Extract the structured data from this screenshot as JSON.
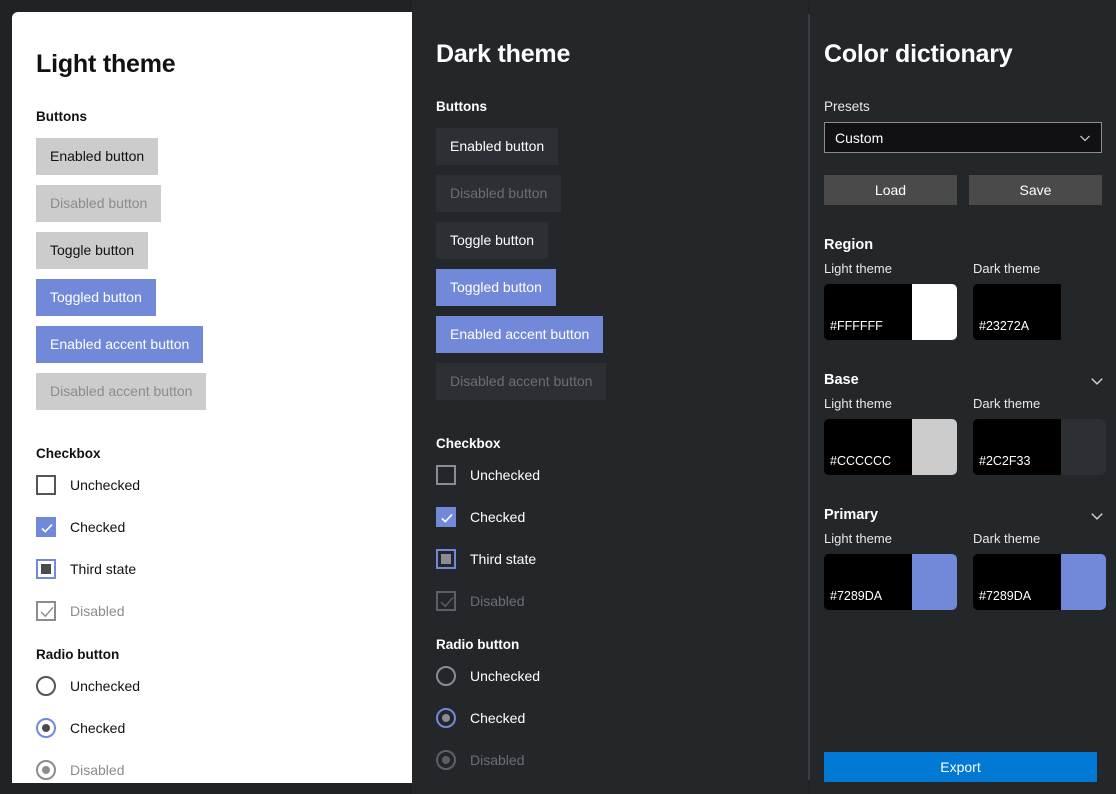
{
  "colors": {
    "accent": "#7289DA",
    "export_blue": "#0078D4",
    "light_bg": "#FFFFFF",
    "dark_bg": "#23272A",
    "dark_base": "#2C2F33",
    "light_base": "#CCCCCC",
    "app_bg": "#202225"
  },
  "light_panel": {
    "title": "Light theme",
    "sections": {
      "buttons": {
        "heading": "Buttons",
        "items": [
          {
            "label": "Enabled button",
            "variant": "default"
          },
          {
            "label": "Disabled button",
            "variant": "disabled"
          },
          {
            "label": "Toggle button",
            "variant": "default"
          },
          {
            "label": "Toggled button",
            "variant": "accent"
          },
          {
            "label": "Enabled accent button",
            "variant": "accent"
          },
          {
            "label": "Disabled accent button",
            "variant": "accentdis"
          }
        ]
      },
      "checkbox": {
        "heading": "Checkbox",
        "items": [
          {
            "label": "Unchecked",
            "state": "unchecked"
          },
          {
            "label": "Checked",
            "state": "checked"
          },
          {
            "label": "Third state",
            "state": "third"
          },
          {
            "label": "Disabled",
            "state": "disabled"
          }
        ]
      },
      "radio": {
        "heading": "Radio button",
        "items": [
          {
            "label": "Unchecked",
            "state": "unchecked"
          },
          {
            "label": "Checked",
            "state": "checked"
          },
          {
            "label": "Disabled",
            "state": "disabled"
          }
        ]
      }
    }
  },
  "dark_panel": {
    "title": "Dark theme",
    "sections": {
      "buttons": {
        "heading": "Buttons",
        "items": [
          {
            "label": "Enabled button",
            "variant": "default"
          },
          {
            "label": "Disabled button",
            "variant": "disabled"
          },
          {
            "label": "Toggle button",
            "variant": "default"
          },
          {
            "label": "Toggled button",
            "variant": "accent"
          },
          {
            "label": "Enabled accent button",
            "variant": "accent"
          },
          {
            "label": "Disabled accent button",
            "variant": "accentdis"
          }
        ]
      },
      "checkbox": {
        "heading": "Checkbox",
        "items": [
          {
            "label": "Unchecked",
            "state": "unchecked"
          },
          {
            "label": "Checked",
            "state": "checked"
          },
          {
            "label": "Third state",
            "state": "third"
          },
          {
            "label": "Disabled",
            "state": "disabled"
          }
        ]
      },
      "radio": {
        "heading": "Radio button",
        "items": [
          {
            "label": "Unchecked",
            "state": "unchecked"
          },
          {
            "label": "Checked",
            "state": "checked"
          },
          {
            "label": "Disabled",
            "state": "disabled"
          }
        ]
      }
    }
  },
  "dictionary": {
    "title": "Color dictionary",
    "presets_label": "Presets",
    "presets_value": "Custom",
    "presets_options": [
      "Custom"
    ],
    "load_label": "Load",
    "save_label": "Save",
    "export_label": "Export",
    "theme_col_light": "Light theme",
    "theme_col_dark": "Dark theme",
    "groups": [
      {
        "name": "Region",
        "has_chevron": false,
        "light": {
          "hex": "#FFFFFF"
        },
        "dark": {
          "hex": "#23272A"
        }
      },
      {
        "name": "Base",
        "has_chevron": true,
        "light": {
          "hex": "#CCCCCC"
        },
        "dark": {
          "hex": "#2C2F33"
        }
      },
      {
        "name": "Primary",
        "has_chevron": true,
        "light": {
          "hex": "#7289DA"
        },
        "dark": {
          "hex": "#7289DA"
        }
      }
    ]
  }
}
